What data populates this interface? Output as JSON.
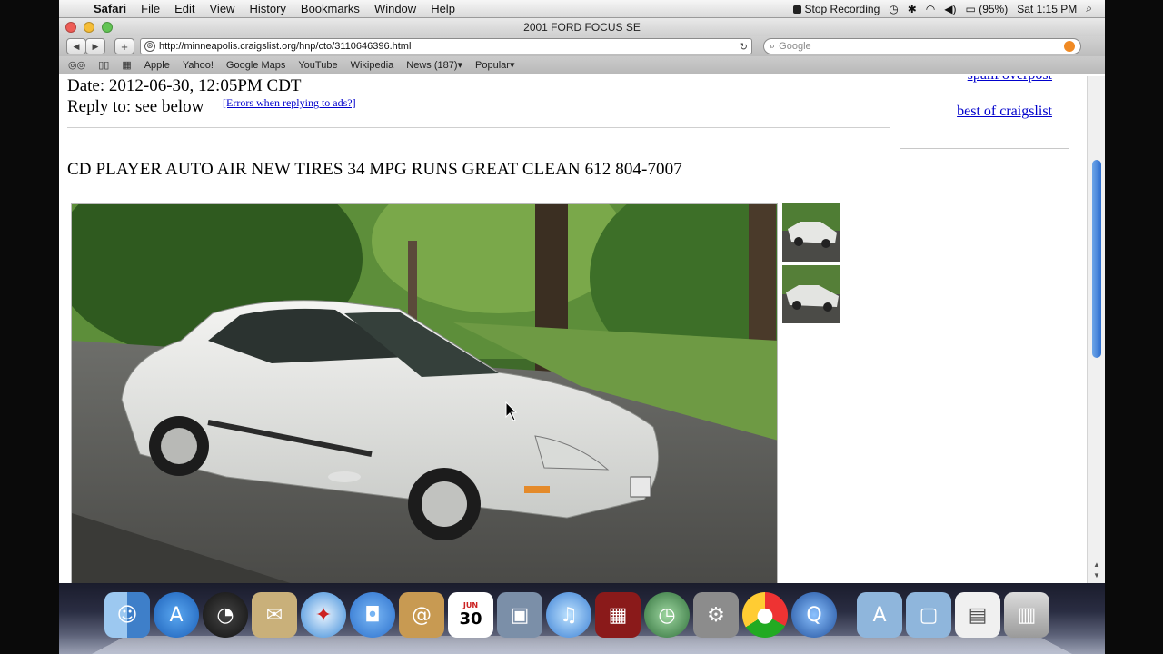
{
  "menubar": {
    "app_name": "Safari",
    "menus": [
      "File",
      "Edit",
      "View",
      "History",
      "Bookmarks",
      "Window",
      "Help"
    ],
    "stop_recording": "Stop Recording",
    "battery": "(95%)",
    "clock": "Sat 1:15 PM"
  },
  "window": {
    "title": "2001 FORD FOCUS SE"
  },
  "toolbar": {
    "url": "http://minneapolis.craigslist.org/hnp/cto/3110646396.html",
    "search_placeholder": "Google"
  },
  "bookmarks": [
    "Apple",
    "Yahoo!",
    "Google Maps",
    "YouTube",
    "Wikipedia",
    "News (187)▾",
    "Popular▾"
  ],
  "post": {
    "date": "Date: 2012-06-30, 12:05PM CDT",
    "reply_to": "Reply to: see below",
    "errors_link": "[Errors when replying to ads?]",
    "title": "CD PLAYER AUTO AIR NEW TIRES 34 MPG RUNS GREAT CLEAN 612 804-7007"
  },
  "sidebar": {
    "spam_link": "spam/overpost",
    "best_link": "best of craigslist"
  },
  "dock": {
    "items": [
      "finder-icon",
      "app-store-icon",
      "dashboard-icon",
      "mail-stamp-icon",
      "safari-icon",
      "ichat-icon",
      "address-book-icon",
      "calendar-icon",
      "photo-booth-icon",
      "itunes-icon",
      "photo-icon",
      "time-machine-icon",
      "system-preferences-icon",
      "chrome-icon",
      "quicktime-icon",
      "applications-folder-icon",
      "documents-folder-icon",
      "preview-icon",
      "trash-icon"
    ],
    "calendar_day": "30",
    "calendar_month": "JUN"
  }
}
